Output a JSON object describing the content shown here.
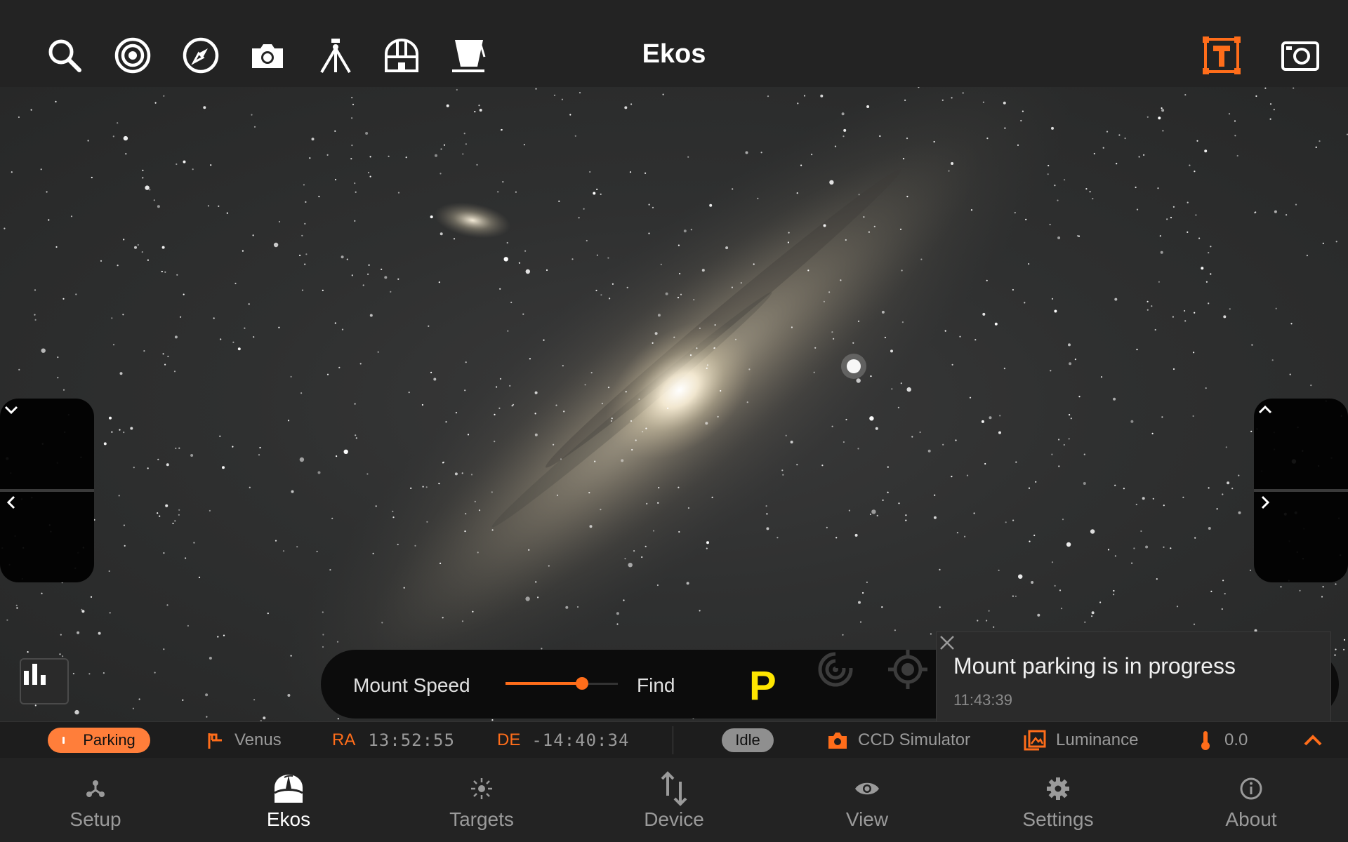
{
  "app": {
    "title": "Ekos"
  },
  "toolbar": {
    "left_icons": [
      "search-icon",
      "target-icon",
      "compass-icon",
      "camera-icon",
      "tripod-icon",
      "observatory-icon",
      "flat-panel-icon"
    ],
    "right_icons": [
      "target-frame-icon",
      "screenshot-icon"
    ],
    "accent_color": "#ff6d1a"
  },
  "mount": {
    "speed_label": "Mount Speed",
    "speed_value": 0.68,
    "mode_label": "Find",
    "park_label": "P"
  },
  "notification": {
    "message": "Mount parking is in progress",
    "time": "11:43:39"
  },
  "status": {
    "mount_state": "Parking",
    "target": "Venus",
    "ra_label": "RA",
    "ra_value": "13:52:55",
    "de_label": "DE",
    "de_value": "-14:40:34",
    "capture_state": "Idle",
    "camera": "CCD Simulator",
    "filter": "Luminance",
    "temperature": "0.0"
  },
  "nav": {
    "active": "Ekos",
    "items": [
      {
        "label": "Setup",
        "icon": "setup-icon"
      },
      {
        "label": "Ekos",
        "icon": "ekos-dome-icon"
      },
      {
        "label": "Targets",
        "icon": "targets-icon"
      },
      {
        "label": "Device",
        "icon": "device-transfer-icon"
      },
      {
        "label": "View",
        "icon": "eye-icon"
      },
      {
        "label": "Settings",
        "icon": "gear-icon"
      },
      {
        "label": "About",
        "icon": "info-icon"
      }
    ]
  }
}
